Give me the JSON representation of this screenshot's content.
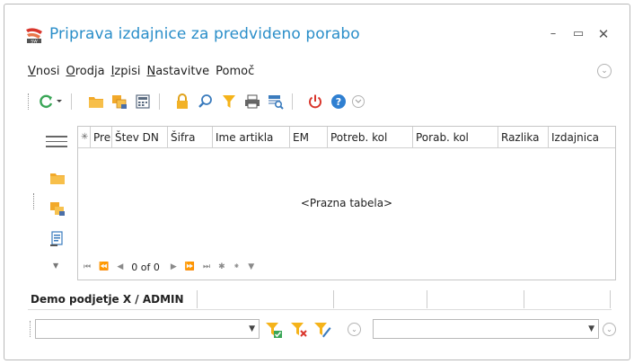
{
  "window": {
    "title": "Priprava izdajnice za predvideno porabo",
    "controls": {
      "minimize": "–",
      "maximize": "▭",
      "close": "✕"
    }
  },
  "menu": {
    "items": [
      {
        "first": "V",
        "rest": "nosi"
      },
      {
        "first": "O",
        "rest": "rodja"
      },
      {
        "first": "I",
        "rest": "zpisi"
      },
      {
        "first": "N",
        "rest": "astavitve"
      },
      {
        "first": "",
        "rest": "Pomoč"
      }
    ]
  },
  "grid": {
    "columns": [
      "Pre",
      "Štev DN",
      "Šifra",
      "Ime artikla",
      "EM",
      "Potreb. kol",
      "Porab. kol",
      "Razlika",
      "Izdajnica"
    ],
    "empty_text": "<Prazna tabela>",
    "navigator_count": "0 of 0"
  },
  "status": {
    "company": "Demo podjetje X / ADMIN"
  },
  "colors": {
    "title": "#2a8ec9",
    "refresh": "#3aa657",
    "folder": "#f2a92a",
    "filter": "#f5b31a",
    "power": "#d9352b",
    "help": "#2f7fd1"
  }
}
